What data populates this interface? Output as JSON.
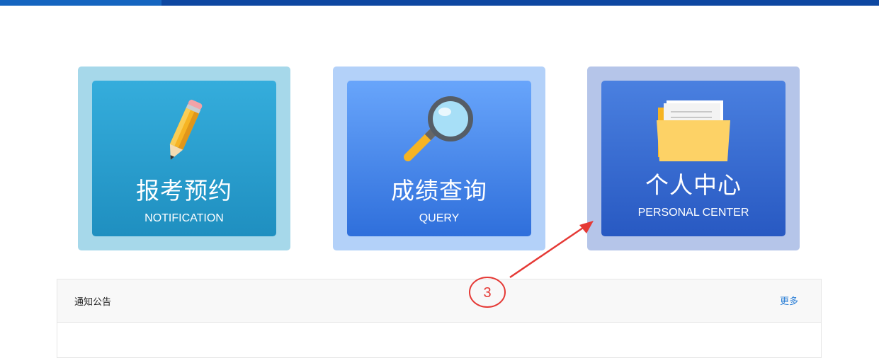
{
  "cards": [
    {
      "title": "报考预约",
      "subtitle": "NOTIFICATION",
      "icon": "pencil-icon"
    },
    {
      "title": "成绩查询",
      "subtitle": "QUERY",
      "icon": "magnifier-icon"
    },
    {
      "title": "个人中心",
      "subtitle": "PERSONAL CENTER",
      "icon": "folder-icon"
    }
  ],
  "notice": {
    "title": "通知公告",
    "more_label": "更多"
  },
  "annotation": {
    "label": "3",
    "color": "#e53935"
  },
  "colors": {
    "top_bar": "#0d47a1",
    "link": "#2b7fd6"
  }
}
